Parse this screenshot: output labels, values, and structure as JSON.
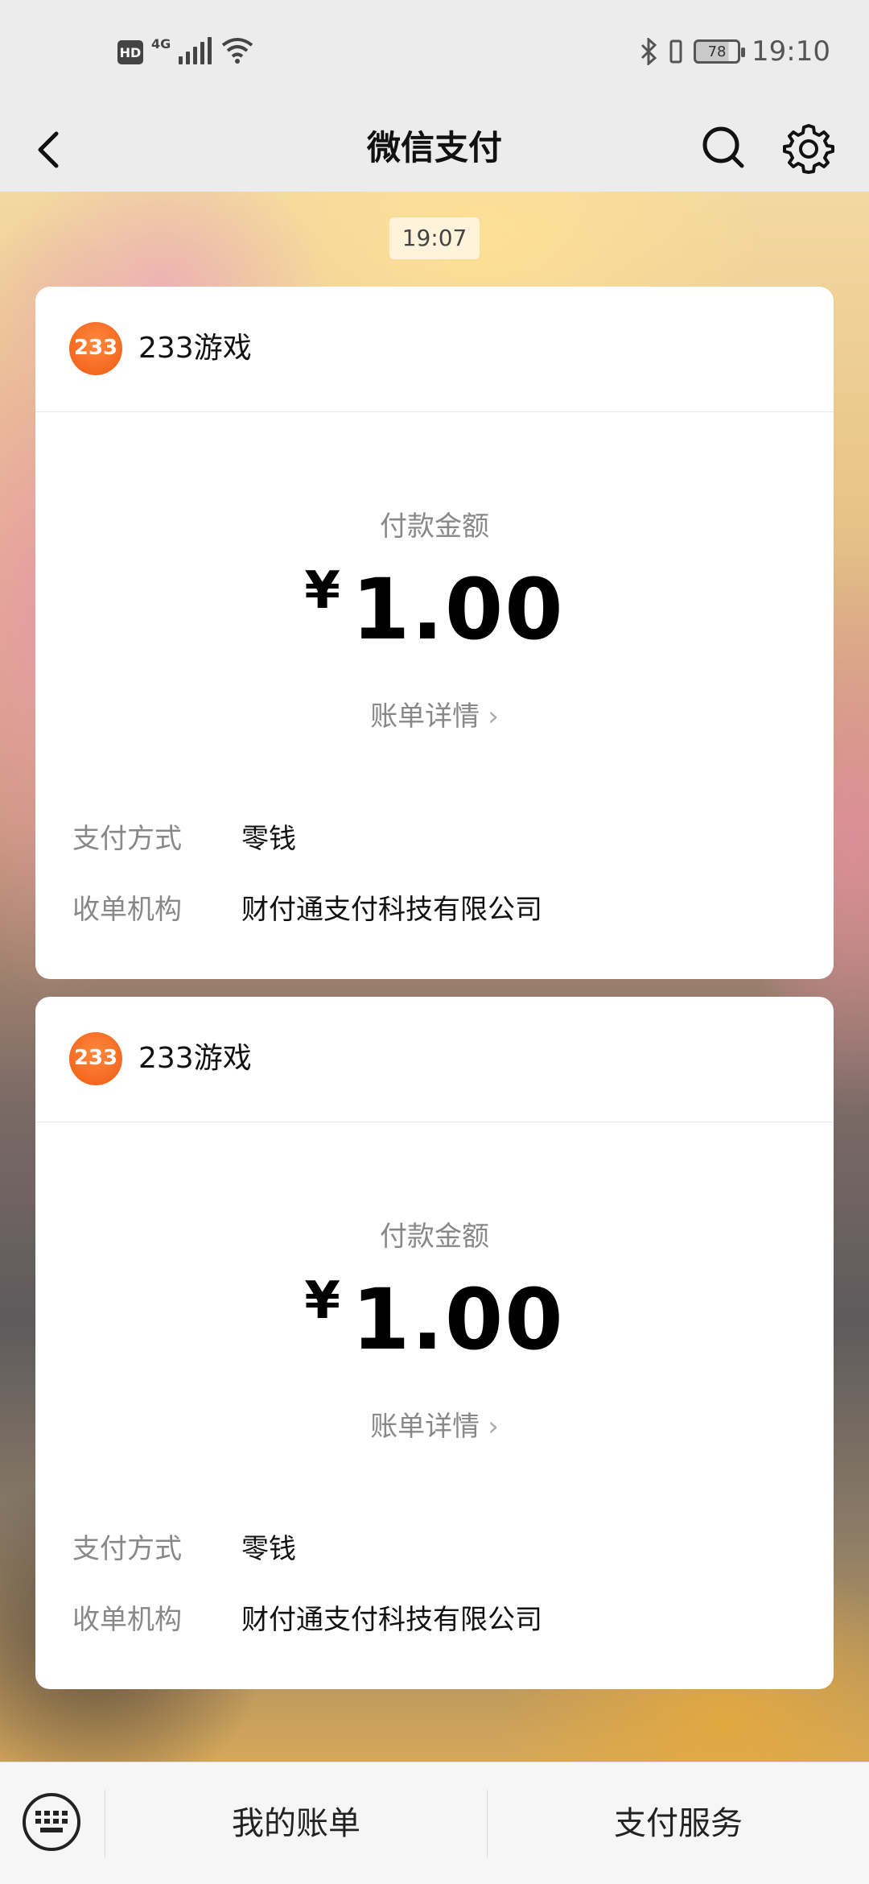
{
  "status_bar": {
    "hd_label": "HD",
    "network_label": "4G",
    "battery_level": "78",
    "time": "19:10"
  },
  "nav": {
    "title": "微信支付"
  },
  "message_time": "19:07",
  "payments": [
    {
      "merchant": "233游戏",
      "logo_text": "233",
      "amount_label": "付款金额",
      "currency": "¥",
      "amount": "1.00",
      "detail_link": "账单详情",
      "method_label": "支付方式",
      "method_value": "零钱",
      "acquirer_label": "收单机构",
      "acquirer_value": "财付通支付科技有限公司"
    },
    {
      "merchant": "233游戏",
      "logo_text": "233",
      "amount_label": "付款金额",
      "currency": "¥",
      "amount": "1.00",
      "detail_link": "账单详情",
      "method_label": "支付方式",
      "method_value": "零钱",
      "acquirer_label": "收单机构",
      "acquirer_value": "财付通支付科技有限公司"
    }
  ],
  "bottom_bar": {
    "my_bills": "我的账单",
    "pay_services": "支付服务"
  },
  "colors": {
    "logo_orange": "#f05a14",
    "card_bg": "#ffffff",
    "bar_bg": "#ececec"
  }
}
